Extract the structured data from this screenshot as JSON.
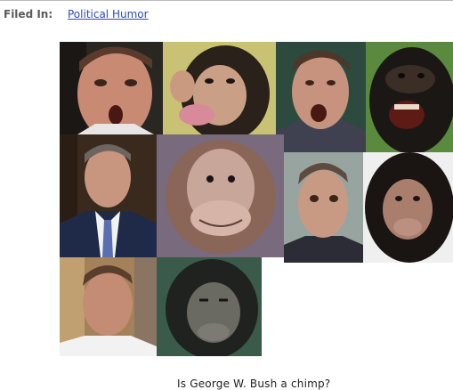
{
  "filed": {
    "label": "Filed In:",
    "link_text": "Political Humor"
  },
  "collage": {
    "tiles": [
      {
        "subject": "man",
        "expression": "mouth open"
      },
      {
        "subject": "chimpanzee",
        "expression": "lips pursed"
      },
      {
        "subject": "man",
        "expression": "mouth open"
      },
      {
        "subject": "chimpanzee",
        "expression": "teeth bared"
      },
      {
        "subject": "man",
        "expression": "neutral"
      },
      {
        "subject": "monkey puppet",
        "expression": "neutral"
      },
      {
        "subject": "man",
        "expression": "eyebrows raised"
      },
      {
        "subject": "chimpanzee",
        "expression": "neutral"
      },
      {
        "subject": "man",
        "expression": "squinting"
      },
      {
        "subject": "chimpanzee",
        "expression": "squinting"
      }
    ]
  },
  "caption": "Is George W. Bush a chimp?"
}
